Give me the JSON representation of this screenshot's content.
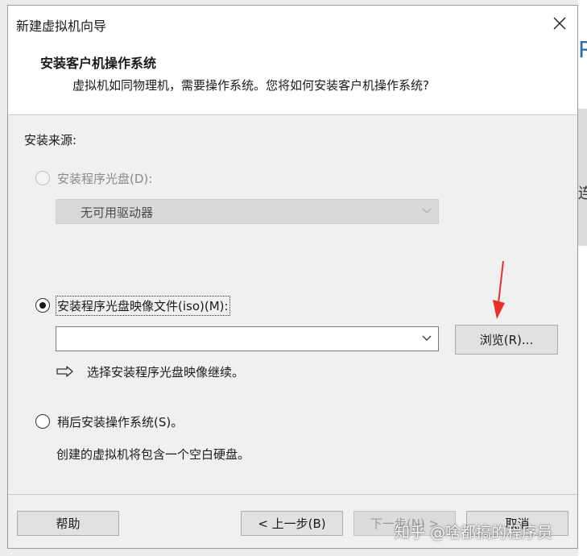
{
  "window": {
    "title": "新建虚拟机向导"
  },
  "header": {
    "title": "安装客户机操作系统",
    "subtitle": "虚拟机如同物理机，需要操作系统。您将如何安装客户机操作系统?"
  },
  "source": {
    "label": "安装来源:",
    "disc": {
      "label": "安装程序光盘(D):",
      "drive_value": "无可用驱动器",
      "enabled": false,
      "selected": false
    },
    "iso": {
      "label": "安装程序光盘映像文件(iso)(M):",
      "path_value": "",
      "browse_label": "浏览(R)...",
      "hint": "选择安装程序光盘映像继续。",
      "selected": true
    },
    "later": {
      "label": "稍后安装操作系统(S)。",
      "description": "创建的虚拟机将包含一个空白硬盘。",
      "selected": false
    }
  },
  "footer": {
    "help_label": "帮助",
    "back_label": "< 上一步(B)",
    "next_label": "下一步(N) >",
    "cancel_label": "取消"
  },
  "watermark": "知乎 @啥都搞的程序员",
  "colors": {
    "arrow": "#e8302a",
    "accent": "#2e6da4"
  }
}
